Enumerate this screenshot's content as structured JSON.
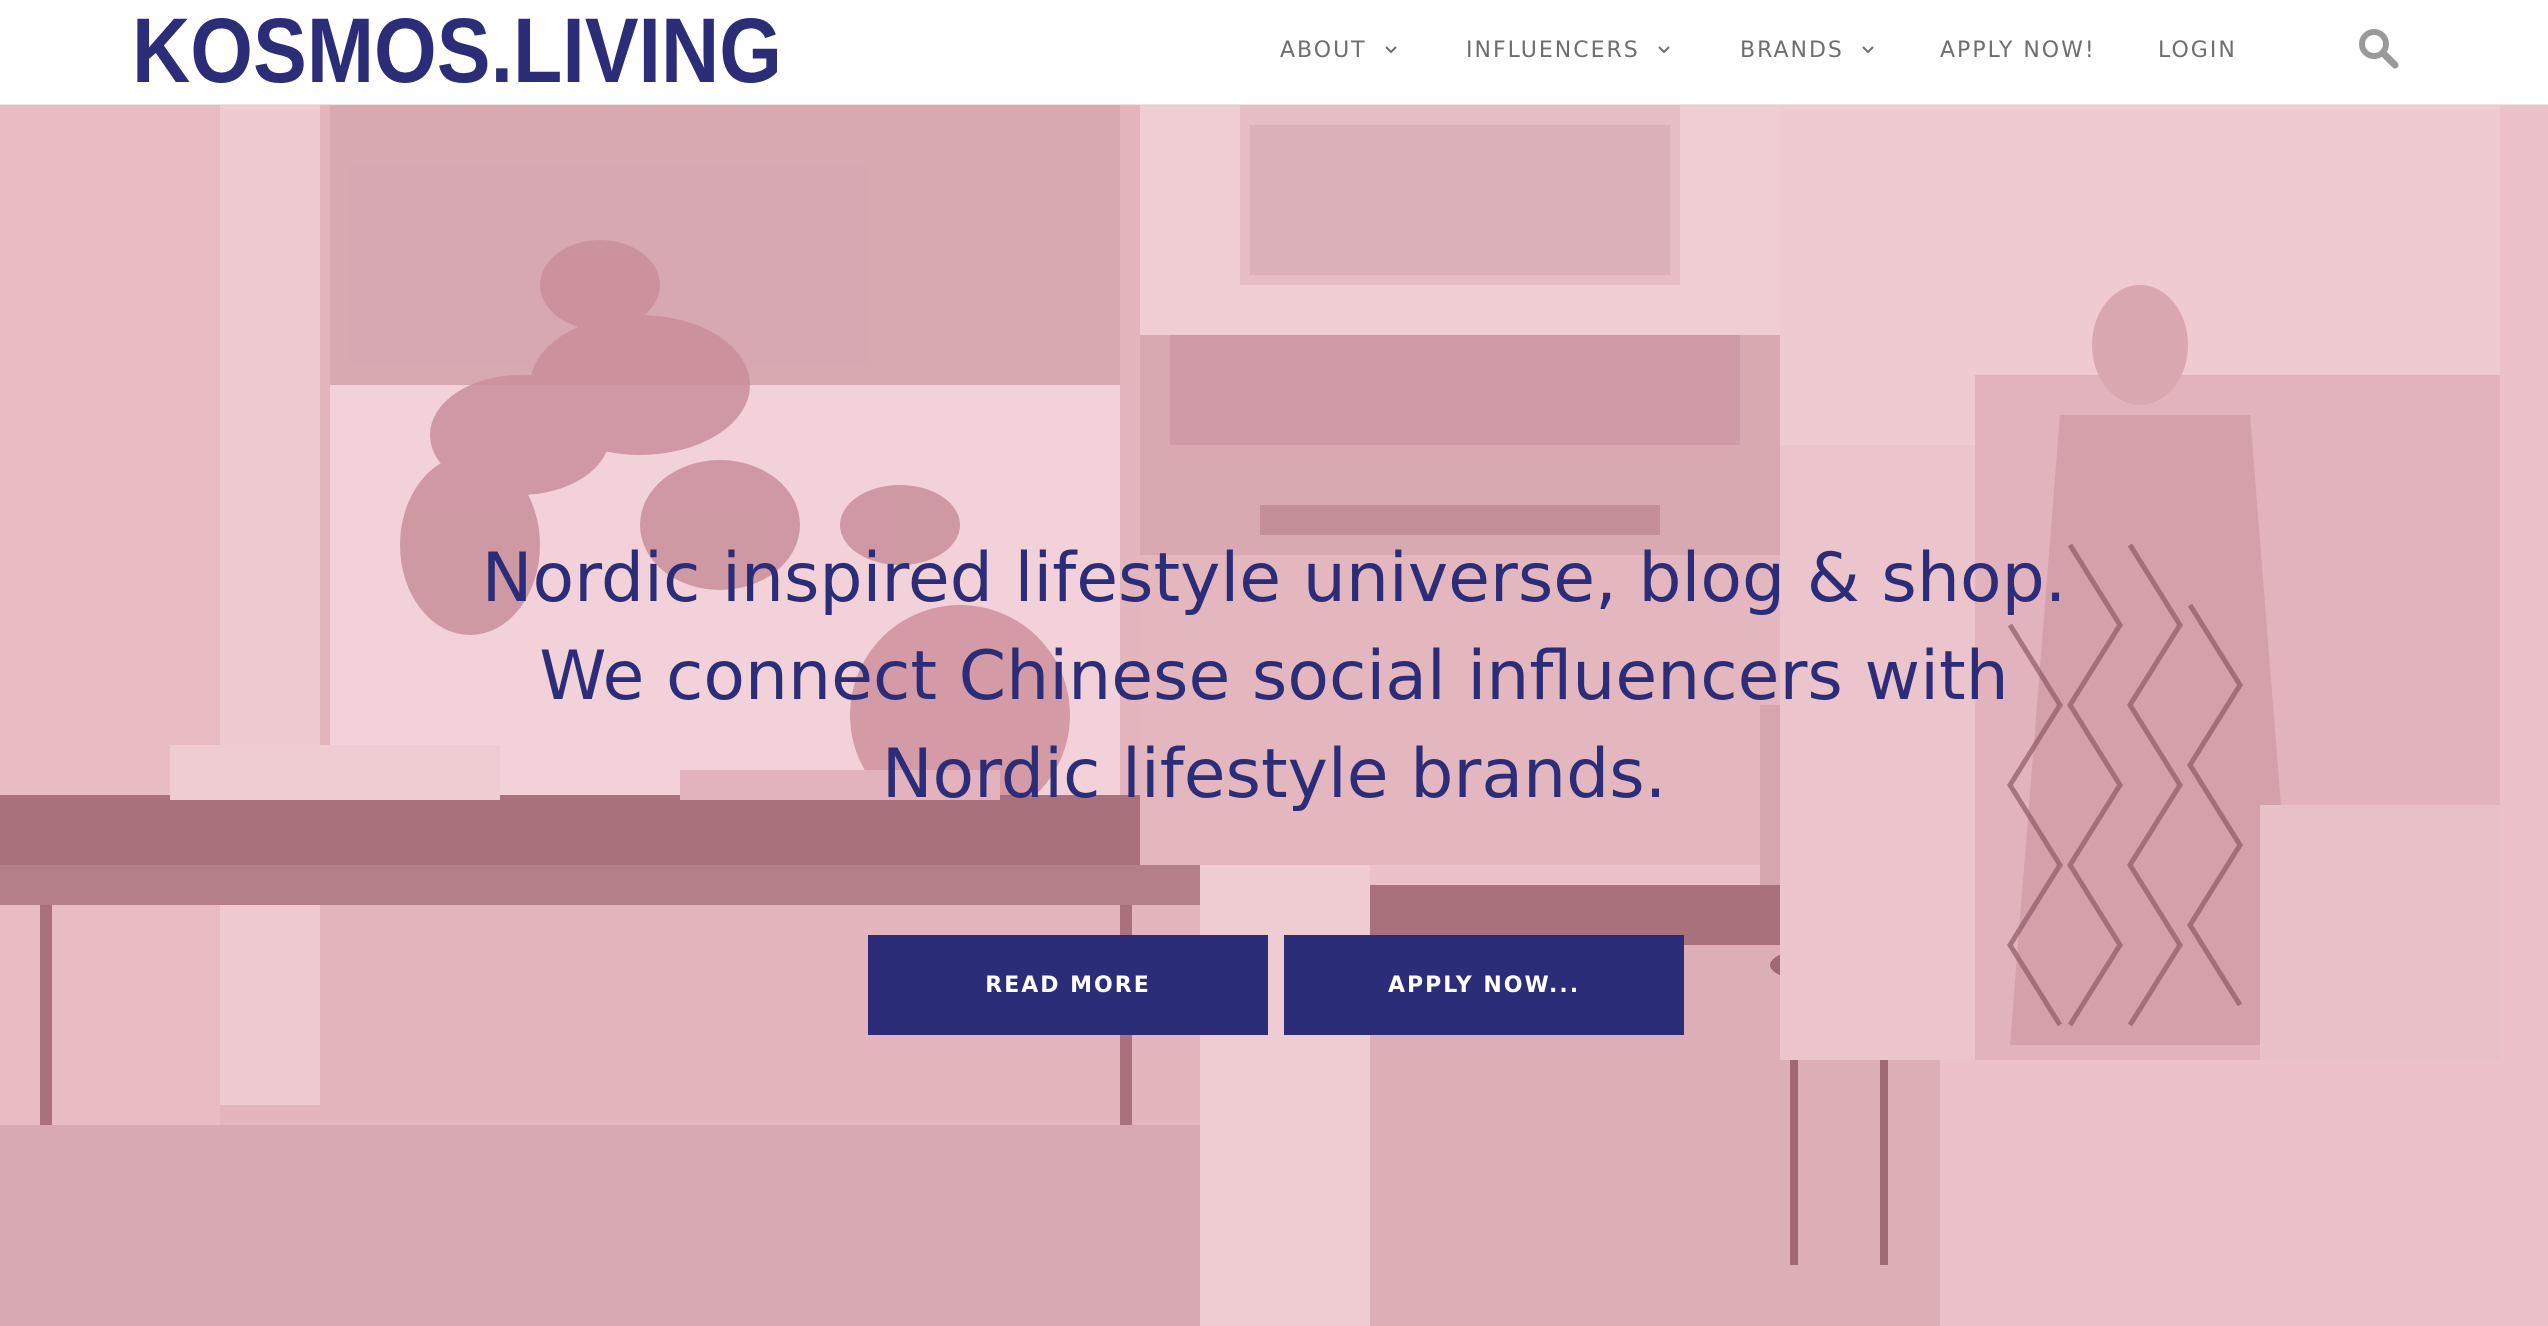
{
  "header": {
    "logo_text": "KOSMOS.LIVING",
    "nav": [
      {
        "label": "ABOUT",
        "has_dropdown": true
      },
      {
        "label": "INFLUENCERS",
        "has_dropdown": true
      },
      {
        "label": "BRANDS",
        "has_dropdown": true
      },
      {
        "label": "APPLY NOW!",
        "has_dropdown": false
      },
      {
        "label": "LOGIN",
        "has_dropdown": false
      }
    ],
    "search_icon": "search-icon"
  },
  "hero": {
    "headline_lines": [
      "Nordic inspired lifestyle universe, blog & shop.",
      "We connect Chinese social influencers with",
      "Nordic lifestyle brands."
    ],
    "buttons": {
      "read_more": "READ MORE",
      "apply_now": "APPLY NOW..."
    }
  },
  "colors": {
    "brand_navy": "#2b2d78",
    "hero_pink": "#ecc1c9",
    "nav_gray": "#6e6e6e"
  }
}
